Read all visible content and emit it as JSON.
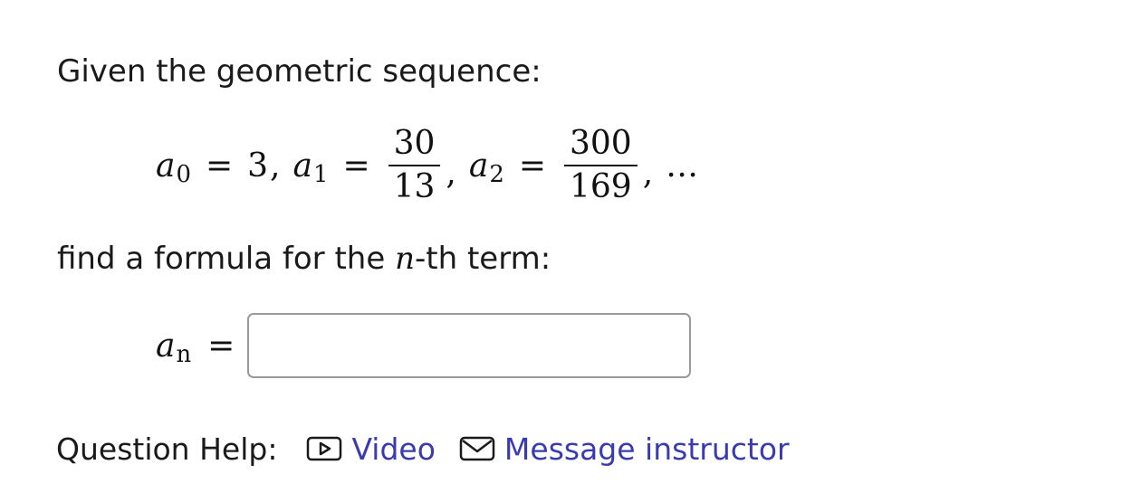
{
  "intro_text": "Given the geometric sequence:",
  "sequence": {
    "a0_symbol": "a",
    "a0_index": "0",
    "a0_value": "3",
    "a1_symbol": "a",
    "a1_index": "1",
    "a1_numerator": "30",
    "a1_denominator": "13",
    "a2_symbol": "a",
    "a2_index": "2",
    "a2_numerator": "300",
    "a2_denominator": "169",
    "ellipsis": "…",
    "equals": "=",
    "comma": ","
  },
  "instruction": {
    "before": "find a formula for the ",
    "variable": "n",
    "after": "-th term:"
  },
  "answer": {
    "symbol": "a",
    "index": "n",
    "equals": "=",
    "value": "",
    "placeholder": ""
  },
  "help": {
    "label": "Question Help:",
    "video_label": "Video",
    "message_label": "Message instructor",
    "link_color": "#3b3bb0"
  }
}
